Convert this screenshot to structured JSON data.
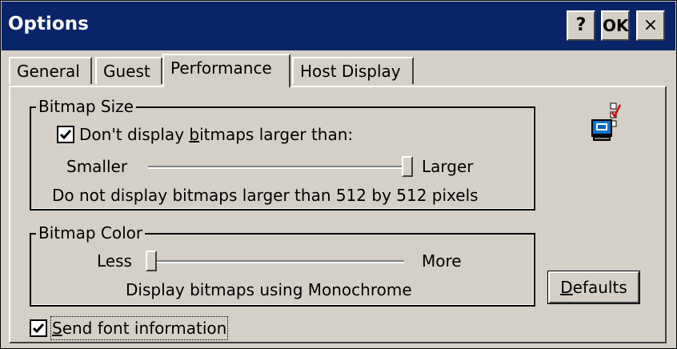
{
  "window": {
    "title": "Options",
    "help_button": "?",
    "ok_button": "OK",
    "close_button": "×"
  },
  "tabs": [
    {
      "label": "General"
    },
    {
      "label": "Guest"
    },
    {
      "label": "Performance",
      "active": true
    },
    {
      "label": "Host Display"
    }
  ],
  "bitmap_size": {
    "legend": "Bitmap Size",
    "checkbox_label_pre": "Don't display ",
    "checkbox_label_accel": "b",
    "checkbox_label_post": "itmaps larger than:",
    "checked": true,
    "slider_min_label": "Smaller",
    "slider_max_label": "Larger",
    "slider_level": 1.0,
    "description": "Do not display bitmaps larger than 512 by 512 pixels"
  },
  "bitmap_color": {
    "legend": "Bitmap Color",
    "slider_min_label": "Less",
    "slider_max_label": "More",
    "slider_level": 0.0,
    "description": "Display bitmaps using Monochrome"
  },
  "send_font": {
    "label_accel": "S",
    "label_rest": "end font information",
    "checked": true
  },
  "defaults_button": {
    "label_accel": "D",
    "label_rest": "efaults"
  },
  "icons": {
    "performance": "computer-checklist-icon"
  }
}
